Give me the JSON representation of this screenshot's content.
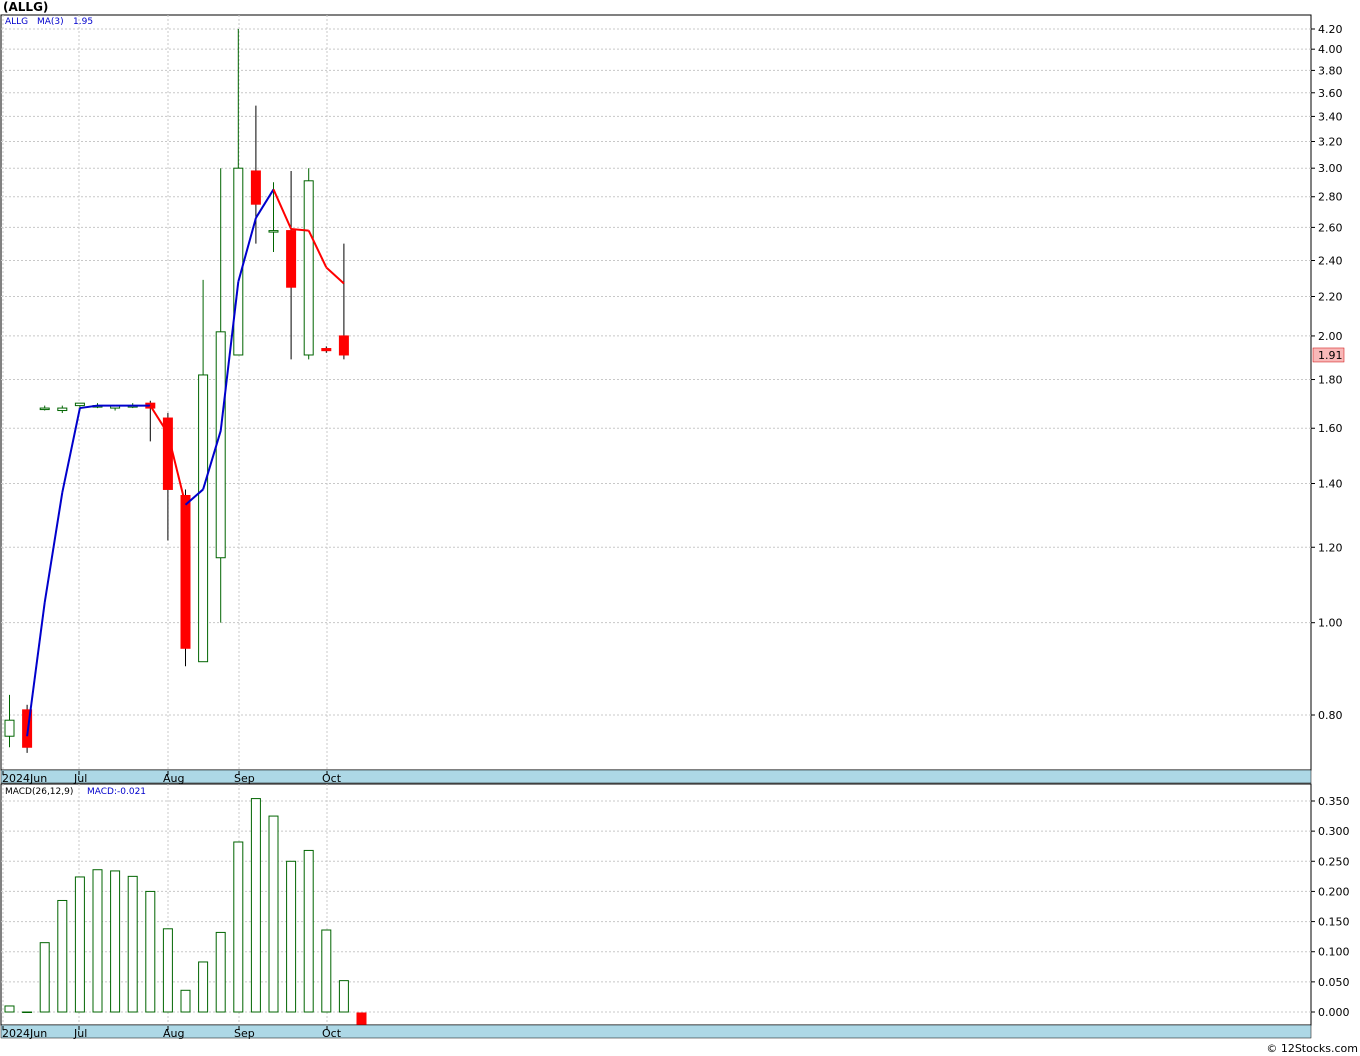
{
  "header": {
    "symbol_title": "(ALLG)"
  },
  "price_panel": {
    "legend_symbol": "ALLG",
    "legend_ma_label": "MA(3)",
    "legend_ma_value": "1.95",
    "last_price_label": "1.91",
    "y_ticks": [
      "4.20",
      "4.00",
      "3.80",
      "3.60",
      "3.40",
      "3.20",
      "3.00",
      "2.80",
      "2.60",
      "2.40",
      "2.20",
      "2.00",
      "1.80",
      "1.60",
      "1.40",
      "1.20",
      "1.00",
      "0.80"
    ]
  },
  "macd_panel": {
    "legend_label": "MACD(26,12,9)",
    "legend_value": "MACD:-0.021",
    "y_ticks": [
      "0.350",
      "0.300",
      "0.250",
      "0.200",
      "0.150",
      "0.100",
      "0.050",
      "0.000"
    ]
  },
  "x_axis": {
    "labels": [
      "2024Jun",
      "Jul",
      "Aug",
      "Sep",
      "Oct"
    ]
  },
  "colors": {
    "up": "#006400",
    "down": "#ff0000",
    "ma_up": "#0000cc",
    "ma_down": "#ff0000",
    "axis_band": "#add8e6",
    "grid": "#c0c0c0"
  },
  "footer": {
    "copyright": "© 12Stocks.com"
  },
  "chart_data": [
    {
      "type": "candlestick",
      "scale": "log",
      "ylim": [
        0.7,
        4.3
      ],
      "x": [
        "2024-06-03",
        "2024-06-10",
        "2024-06-17",
        "2024-06-24",
        "2024-07-01",
        "2024-07-08",
        "2024-07-15",
        "2024-07-22",
        "2024-07-29",
        "2024-08-05",
        "2024-08-12",
        "2024-08-19",
        "2024-08-26",
        "2024-09-02",
        "2024-09-09",
        "2024-09-16",
        "2024-09-23",
        "2024-09-30",
        "2024-10-07",
        "2024-10-14"
      ],
      "open": [
        0.76,
        0.81,
        1.68,
        1.67,
        1.69,
        1.69,
        1.68,
        1.69,
        1.7,
        1.64,
        1.36,
        0.91,
        1.17,
        1.91,
        2.98,
        2.58,
        2.58,
        1.91,
        1.94,
        2.0
      ],
      "high": [
        0.84,
        0.82,
        1.69,
        1.69,
        1.7,
        1.7,
        1.69,
        1.7,
        1.71,
        1.66,
        1.38,
        2.29,
        3.0,
        4.2,
        3.49,
        2.9,
        2.98,
        3.0,
        1.95,
        2.5
      ],
      "low": [
        0.74,
        0.73,
        1.67,
        1.66,
        1.68,
        1.68,
        1.67,
        1.68,
        1.55,
        1.22,
        0.9,
        0.91,
        1.0,
        1.91,
        2.5,
        2.45,
        1.89,
        1.89,
        1.92,
        1.89
      ],
      "close": [
        0.79,
        0.74,
        1.68,
        1.68,
        1.7,
        1.69,
        1.69,
        1.69,
        1.68,
        1.38,
        0.94,
        1.82,
        2.02,
        3.0,
        2.75,
        2.58,
        2.25,
        2.91,
        1.93,
        1.91
      ],
      "ma3": [
        null,
        0.76,
        1.05,
        1.37,
        1.68,
        1.69,
        1.69,
        1.69,
        1.69,
        1.58,
        1.33,
        1.38,
        1.59,
        2.28,
        2.66,
        2.85,
        2.59,
        2.58,
        2.36,
        2.27
      ]
    },
    {
      "type": "bar",
      "title": "MACD(26,12,9)",
      "ylim": [
        -0.02,
        0.37
      ],
      "x": [
        "2024-06-03",
        "2024-06-10",
        "2024-06-17",
        "2024-06-24",
        "2024-07-01",
        "2024-07-08",
        "2024-07-15",
        "2024-07-22",
        "2024-07-29",
        "2024-08-05",
        "2024-08-12",
        "2024-08-19",
        "2024-08-26",
        "2024-09-02",
        "2024-09-09",
        "2024-09-16",
        "2024-09-23",
        "2024-09-30",
        "2024-10-07",
        "2024-10-14"
      ],
      "values": [
        0.01,
        0.0,
        0.115,
        0.185,
        0.224,
        0.236,
        0.234,
        0.225,
        0.2,
        0.138,
        0.036,
        0.083,
        0.132,
        0.282,
        0.354,
        0.325,
        0.25,
        0.268,
        0.136,
        0.052,
        -0.021
      ]
    }
  ]
}
